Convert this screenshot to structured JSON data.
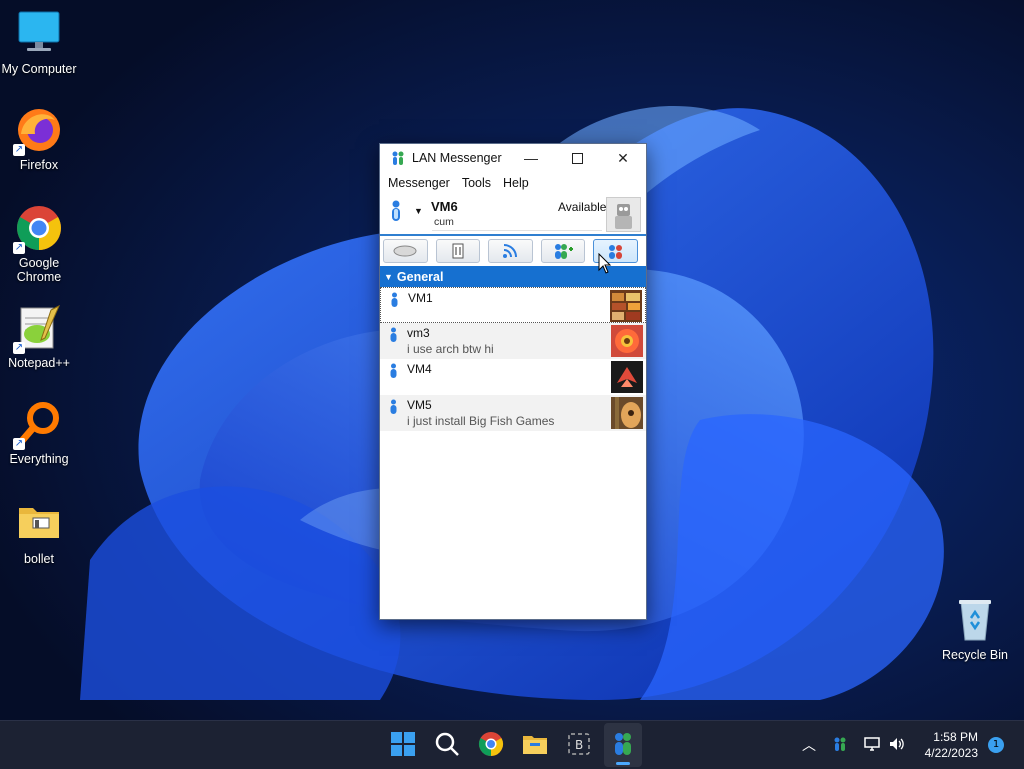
{
  "desktop": {
    "icons": [
      {
        "label": "My Computer"
      },
      {
        "label": "Firefox"
      },
      {
        "label": "Google Chrome"
      },
      {
        "label": "Notepad++"
      },
      {
        "label": "Everything"
      },
      {
        "label": "bollet"
      }
    ],
    "recycle_bin": "Recycle Bin"
  },
  "window": {
    "title": "LAN Messenger",
    "menu": [
      "Messenger",
      "Tools",
      "Help"
    ],
    "profile": {
      "name": "VM6",
      "status": "Available",
      "note": "cum"
    },
    "toolbar": [
      "chat-room",
      "broadcast-message",
      "public-message",
      "add-contacts",
      "send-message"
    ],
    "group": "General",
    "contacts": [
      {
        "name": "VM1",
        "note": ""
      },
      {
        "name": "vm3",
        "note": "i use arch btw hi"
      },
      {
        "name": "VM4",
        "note": ""
      },
      {
        "name": "VM5",
        "note": "i just install Big Fish Games"
      }
    ]
  },
  "taskbar": {
    "time": "1:58 PM",
    "date": "4/22/2023",
    "notification_count": "1"
  },
  "colors": {
    "accent": "#1670d0",
    "taskbar": "#1c2233"
  }
}
